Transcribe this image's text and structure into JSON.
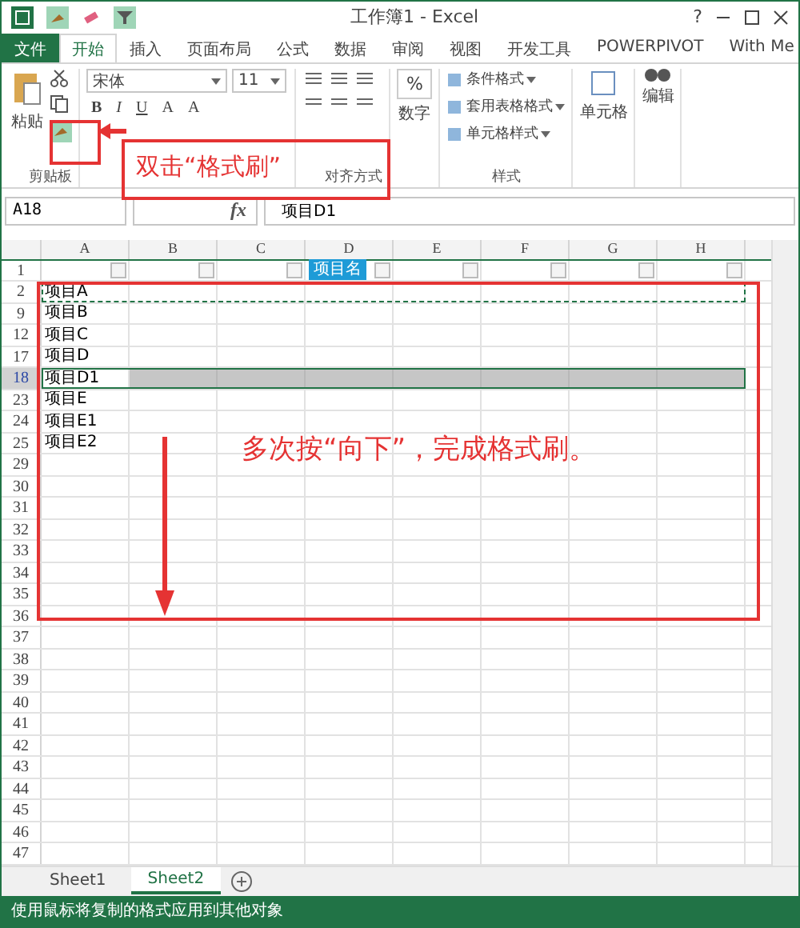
{
  "window": {
    "title": "工作簿1 - Excel",
    "controls": [
      "?"
    ]
  },
  "tabs": [
    {
      "label": "文件",
      "kind": "file",
      "selected": false
    },
    {
      "label": "开始",
      "kind": "tab",
      "selected": true
    },
    {
      "label": "插入",
      "kind": "tab",
      "selected": false
    },
    {
      "label": "页面布局",
      "kind": "tab",
      "selected": false
    },
    {
      "label": "公式",
      "kind": "tab",
      "selected": false
    },
    {
      "label": "数据",
      "kind": "tab",
      "selected": false
    },
    {
      "label": "审阅",
      "kind": "tab",
      "selected": false
    },
    {
      "label": "视图",
      "kind": "tab",
      "selected": false
    },
    {
      "label": "开发工具",
      "kind": "tab",
      "selected": false
    },
    {
      "label": "POWERPIVOT",
      "kind": "tab",
      "selected": false
    },
    {
      "label": "With Me",
      "kind": "account",
      "selected": false
    }
  ],
  "ribbon": {
    "paste": "粘贴",
    "clipboard_label": "剪贴板",
    "font_name": "宋体",
    "font_size": "11",
    "bold": "B",
    "italic": "I",
    "underline": "U",
    "grow": "A",
    "shrink": "A",
    "align_label": "对齐方式",
    "number_symbol": "%",
    "number_label": "数字",
    "styles": [
      "条件格式",
      "套用表格格式",
      "单元格样式"
    ],
    "styles_label": "样式",
    "cells_label": "单元格",
    "edit_label": "编辑"
  },
  "formula_bar": {
    "name_box": "A18",
    "fx": "fx",
    "value": "项目D1"
  },
  "columns": [
    "A",
    "B",
    "C",
    "D",
    "E",
    "F",
    "G",
    "H"
  ],
  "header_row": {
    "number": "1",
    "cells": [
      {},
      {},
      {},
      {
        "text": "项目名"
      },
      {},
      {},
      {},
      {}
    ]
  },
  "rows": [
    {
      "number": "2",
      "text": "项目A",
      "copied": true,
      "selected": false
    },
    {
      "number": "9",
      "text": "项目B",
      "copied": false,
      "selected": false
    },
    {
      "number": "12",
      "text": "项目C",
      "copied": false,
      "selected": false
    },
    {
      "number": "17",
      "text": "项目D",
      "copied": false,
      "selected": false
    },
    {
      "number": "18",
      "text": "项目D1",
      "copied": false,
      "selected": true
    },
    {
      "number": "23",
      "text": "项目E",
      "copied": false,
      "selected": false
    },
    {
      "number": "24",
      "text": "项目E1",
      "copied": false,
      "selected": false
    },
    {
      "number": "25",
      "text": "项目E2",
      "copied": false,
      "selected": false
    },
    {
      "number": "29"
    },
    {
      "number": "30"
    },
    {
      "number": "31"
    },
    {
      "number": "32"
    },
    {
      "number": "33"
    },
    {
      "number": "34"
    },
    {
      "number": "35"
    },
    {
      "number": "36"
    },
    {
      "number": "37"
    },
    {
      "number": "38"
    },
    {
      "number": "39"
    },
    {
      "number": "40"
    },
    {
      "number": "41"
    },
    {
      "number": "42"
    },
    {
      "number": "43"
    },
    {
      "number": "44"
    },
    {
      "number": "45"
    },
    {
      "number": "46"
    },
    {
      "number": "47"
    }
  ],
  "sheets": [
    {
      "label": "Sheet1",
      "selected": false
    },
    {
      "label": "Sheet2",
      "selected": true
    }
  ],
  "status_bar": "使用鼠标将复制的格式应用到其他对象",
  "annotations": [
    {
      "text": "双击“格式刷”"
    },
    {
      "text": "多次按“向下”，完成格式刷。"
    }
  ]
}
